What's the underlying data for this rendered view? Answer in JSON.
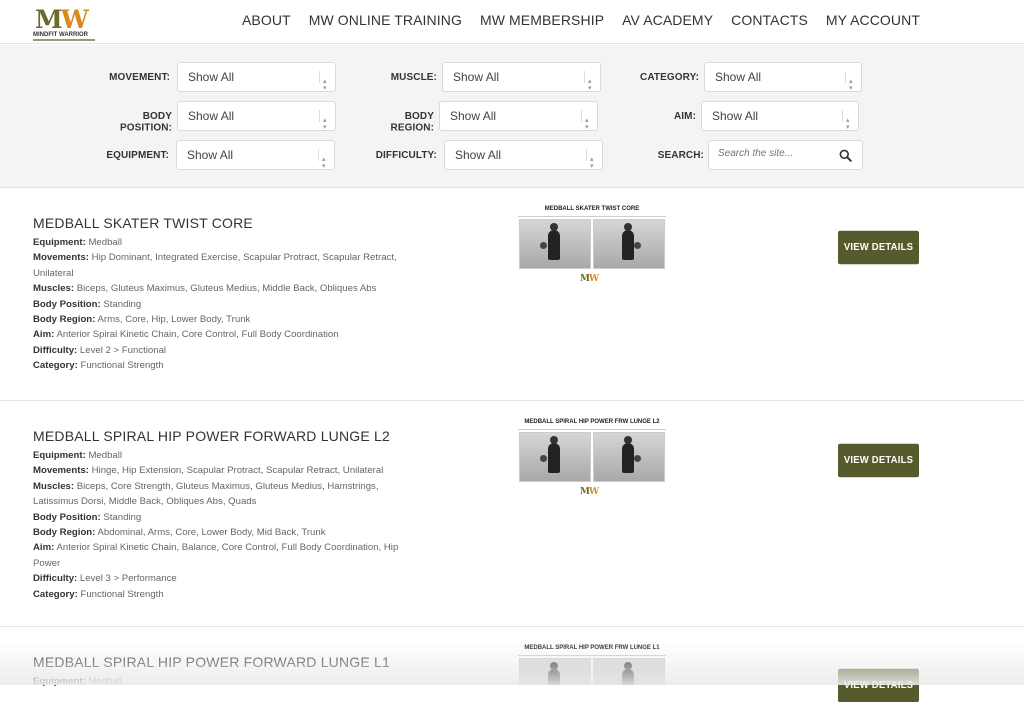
{
  "header": {
    "logo_text": "MW",
    "logo_subtitle": "MINDFIT WARRIOR",
    "nav": [
      "ABOUT",
      "MW ONLINE TRAINING",
      "MW MEMBERSHIP",
      "AV ACADEMY",
      "CONTACTS",
      "MY ACCOUNT"
    ]
  },
  "filters": {
    "movement": {
      "label": "MOVEMENT:",
      "value": "Show All"
    },
    "muscle": {
      "label": "MUSCLE:",
      "value": "Show All"
    },
    "category": {
      "label": "CATEGORY:",
      "value": "Show All"
    },
    "body_position": {
      "label": "BODY POSITION:",
      "value": "Show All"
    },
    "body_region": {
      "label": "BODY REGION:",
      "value": "Show All"
    },
    "aim": {
      "label": "AIM:",
      "value": "Show All"
    },
    "equipment": {
      "label": "EQUIPMENT:",
      "value": "Show All"
    },
    "difficulty": {
      "label": "DIFFICULTY:",
      "value": "Show All"
    },
    "search": {
      "label": "SEARCH:",
      "placeholder": "Search the site..."
    }
  },
  "field_labels": {
    "equipment": "Equipment:",
    "movements": "Movements:",
    "muscles": "Muscles:",
    "body_position": "Body Position:",
    "body_region": "Body Region:",
    "aim": "Aim:",
    "difficulty": "Difficulty:",
    "category": "Category:"
  },
  "button_label": "VIEW DETAILS",
  "results": [
    {
      "title": "MEDBALL SKATER TWIST CORE",
      "thumb_title": "MEDBALL SKATER TWIST CORE",
      "equipment": "Medball",
      "movements": "Hip Dominant, Integrated Exercise, Scapular Protract, Scapular Retract, Unilateral",
      "muscles": "Biceps, Gluteus Maximus, Gluteus Medius, Middle Back, Obliques Abs",
      "body_position": "Standing",
      "body_region": "Arms, Core, Hip, Lower Body, Trunk",
      "aim": "Anterior Spiral Kinetic Chain, Core Control, Full Body Coordination",
      "difficulty": "Level 2 > Functional",
      "category": "Functional Strength"
    },
    {
      "title": "MEDBALL SPIRAL HIP POWER FORWARD LUNGE L2",
      "thumb_title": "MEDBALL SPIRAL HIP POWER FRW LUNGE L2",
      "equipment": "Medball",
      "movements": "Hinge, Hip Extension, Scapular Protract, Scapular Retract, Unilateral",
      "muscles": "Biceps, Core Strength, Gluteus Maximus, Gluteus Medius, Hamstrings, Latissimus Dorsi, Middle Back, Obliques Abs, Quads",
      "body_position": "Standing",
      "body_region": "Abdominal, Arms, Core, Lower Body, Mid Back, Trunk",
      "aim": "Anterior Spiral Kinetic Chain, Balance, Core Control, Full Body Coordination, Hip Power",
      "difficulty": "Level 3 > Performance",
      "category": "Functional Strength"
    },
    {
      "title": "MEDBALL SPIRAL HIP POWER FORWARD LUNGE L1",
      "thumb_title": "MEDBALL SPIRAL HIP POWER FRW LUNGE L1",
      "equipment": "Medball"
    }
  ]
}
